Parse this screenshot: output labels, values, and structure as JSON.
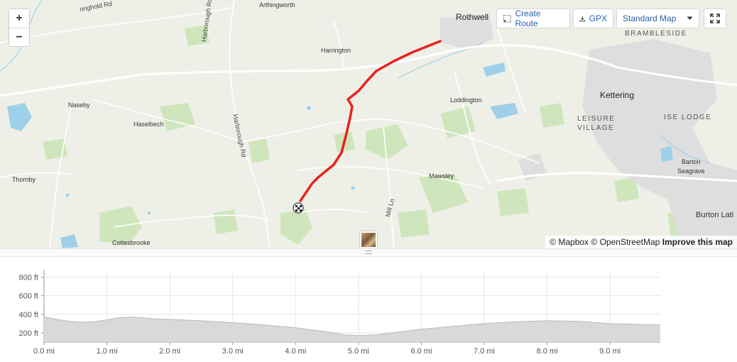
{
  "map": {
    "zoom_in_label": "+",
    "zoom_out_label": "−",
    "toolbar": {
      "create_route_label": "Create Route",
      "gpx_label": "GPX",
      "map_style_label": "Standard Map",
      "icons": [
        "route-select-icon",
        "download-icon",
        "caret-down-icon",
        "fullscreen-icon"
      ]
    },
    "places": {
      "arthingworth": "Arthingworth",
      "rothwell": "Rothwell",
      "brambleside": "BRAMBLESIDE",
      "harrington": "Harrington",
      "kettering": "Kettering",
      "naseby": "Naseby",
      "loddington": "Loddington",
      "leisure": "LEISURE",
      "village": "VILLAGE",
      "ise_lodge": "ISE LODGE",
      "haselbech": "Haselbech",
      "barton": "Barton",
      "seagrave": "Seagrave",
      "thornby": "Thornby",
      "mawsley": "Mawsley",
      "burton_lati": "Burton Lati",
      "cottesbrooke": "Cottesbrooke"
    },
    "roads": {
      "longhold_rd": "onghold Rd",
      "harborough_rd_north": "Harborough Rd",
      "harborough_rd_south": "Harborough Rd",
      "mill_ln": "Mill Ln"
    },
    "attribution": {
      "mapbox": "© Mapbox",
      "osm": "© OpenStreetMap",
      "improve": "Improve this map"
    },
    "colors": {
      "route": "#e8231b",
      "land": "#eef0e8",
      "woods": "#c9e3b4",
      "water": "#8cc8e6",
      "urban": "#dcdcdc",
      "road": "#ffffff"
    }
  },
  "chart_data": {
    "type": "area",
    "xlabel": "",
    "ylabel": "",
    "x_unit": "mi",
    "y_unit": "ft",
    "xlim": [
      0,
      9.8
    ],
    "ylim": [
      100,
      850
    ],
    "x_ticks": [
      "0.0 mi",
      "1.0 mi",
      "2.0 mi",
      "3.0 mi",
      "4.0 mi",
      "5.0 mi",
      "6.0 mi",
      "7.0 mi",
      "8.0 mi",
      "9.0 mi"
    ],
    "y_ticks": [
      "200 ft",
      "400 ft",
      "600 ft",
      "800 ft"
    ],
    "series": [
      {
        "x": [
          0.0,
          0.2,
          0.4,
          0.6,
          0.8,
          1.0,
          1.2,
          1.4,
          1.6,
          1.8,
          2.0,
          2.5,
          3.0,
          3.5,
          4.0,
          4.5,
          4.8,
          5.0,
          5.3,
          5.6,
          6.0,
          6.5,
          7.0,
          7.5,
          8.0,
          8.5,
          9.0,
          9.5,
          9.8
        ],
        "y": [
          375,
          345,
          325,
          315,
          320,
          340,
          365,
          370,
          360,
          350,
          345,
          330,
          310,
          285,
          255,
          210,
          178,
          170,
          180,
          205,
          240,
          270,
          300,
          320,
          330,
          325,
          300,
          290,
          285
        ]
      }
    ],
    "fill_color": "#d9d9d9",
    "line_color": "#b9b9b9",
    "grid": true
  }
}
